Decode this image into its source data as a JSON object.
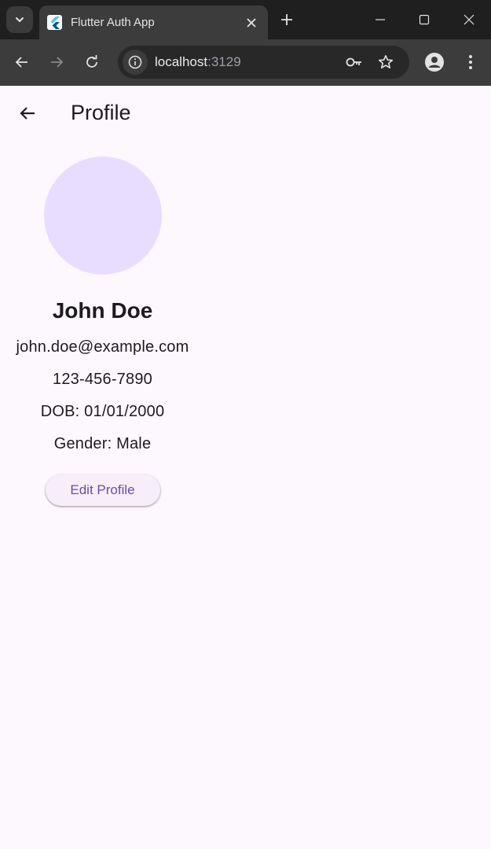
{
  "browser": {
    "tab_title": "Flutter Auth App",
    "url_host": "localhost",
    "url_port": ":3129"
  },
  "app_bar": {
    "title": "Profile"
  },
  "profile": {
    "name": "John Doe",
    "email": "john.doe@example.com",
    "phone": "123-456-7890",
    "dob": "DOB: 01/01/2000",
    "gender": "Gender: Male",
    "edit_label": "Edit Profile"
  },
  "colors": {
    "background": "#fdf7fe",
    "avatar": "#e9ddff",
    "accent": "#6750a4",
    "text": "#1d1b20"
  },
  "icons": [
    "tab-search-icon",
    "flutter-favicon-icon",
    "close-icon",
    "plus-icon",
    "minimize-icon",
    "maximize-icon",
    "back-arrow-icon",
    "forward-arrow-icon",
    "reload-icon",
    "info-icon",
    "key-icon",
    "star-icon",
    "account-icon",
    "kebab-menu-icon"
  ]
}
